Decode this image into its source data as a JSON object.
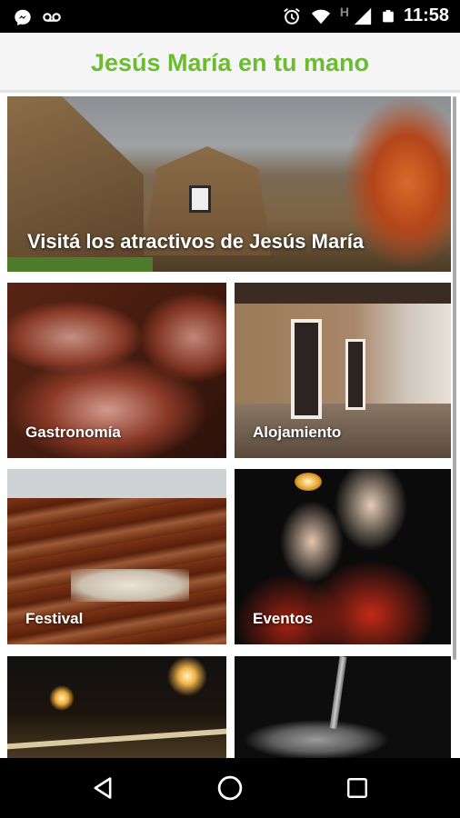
{
  "status_bar": {
    "time": "11:58",
    "network_type": "H",
    "icons": [
      "messenger-icon",
      "voicemail-icon",
      "alarm-icon",
      "wifi-icon",
      "signal-icon",
      "battery-icon"
    ]
  },
  "app_bar": {
    "title": "Jesús María en tu mano",
    "title_color": "#6bbd2f"
  },
  "hero": {
    "label": "Visitá los atractivos de Jesús María"
  },
  "tiles": [
    {
      "label": "Gastronomía"
    },
    {
      "label": "Alojamiento"
    },
    {
      "label": "Festival"
    },
    {
      "label": "Eventos"
    },
    {
      "label": ""
    },
    {
      "label": ""
    }
  ],
  "nav_bar": {
    "icons": [
      "back-icon",
      "home-icon",
      "recents-icon"
    ]
  }
}
